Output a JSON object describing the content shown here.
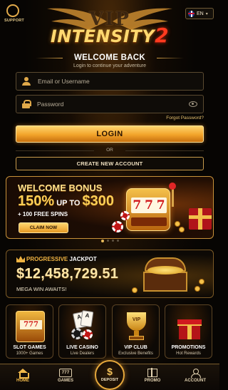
{
  "header": {
    "support_label": "SUPPORT",
    "language": "EN",
    "logo_top": "VIP",
    "logo_main": "INTENSITY",
    "logo_number": "2"
  },
  "login": {
    "title": "WELCOME BACK",
    "subtitle": "Login to continue your adventure",
    "username_placeholder": "Email or Username",
    "password_placeholder": "Password",
    "forgot_label": "Forgot Password?",
    "login_label": "LOGIN",
    "or_label": "OR",
    "create_label": "CREATE NEW ACCOUNT"
  },
  "bonus": {
    "line1": "WELCOME BONUS",
    "percent": "150%",
    "upto": " UP TO ",
    "amount": "$300",
    "spins": "+ 100 FREE SPINS",
    "claim_label": "CLAIM NOW",
    "slot_symbols": [
      "7",
      "7",
      "7"
    ],
    "carousel_count": 4,
    "carousel_active": 1
  },
  "jackpot": {
    "label_prefix": "PROGRESSIVE",
    "label_suffix": " JACKPOT",
    "amount": "$12,458,729.51",
    "tagline": "MEGA WIN AWAITS!"
  },
  "categories": [
    {
      "title": "SLOT GAMES",
      "subtitle": "1000+ Games",
      "icon": "slot-machine-icon",
      "art_text": "777"
    },
    {
      "title": "LIVE CASINO",
      "subtitle": "Live Dealers",
      "icon": "cards-chips-icon",
      "art_text": "A"
    },
    {
      "title": "VIP CLUB",
      "subtitle": "Exclusive Benefits",
      "icon": "trophy-icon",
      "art_text": "VIP"
    },
    {
      "title": "PROMOTIONS",
      "subtitle": "Hot Rewards",
      "icon": "gift-icon",
      "art_text": ""
    }
  ],
  "nav": {
    "home": "HOME",
    "games": "GAMES",
    "games_icon_text": "777",
    "deposit": "DEPOSIT",
    "deposit_symbol": "$",
    "promo": "PROMO",
    "account": "ACCOUNT"
  },
  "colors": {
    "accent": "#f1b94a",
    "accent_dark": "#c7700e",
    "background": "#070503",
    "jackpot_red": "#ff3a1f"
  }
}
